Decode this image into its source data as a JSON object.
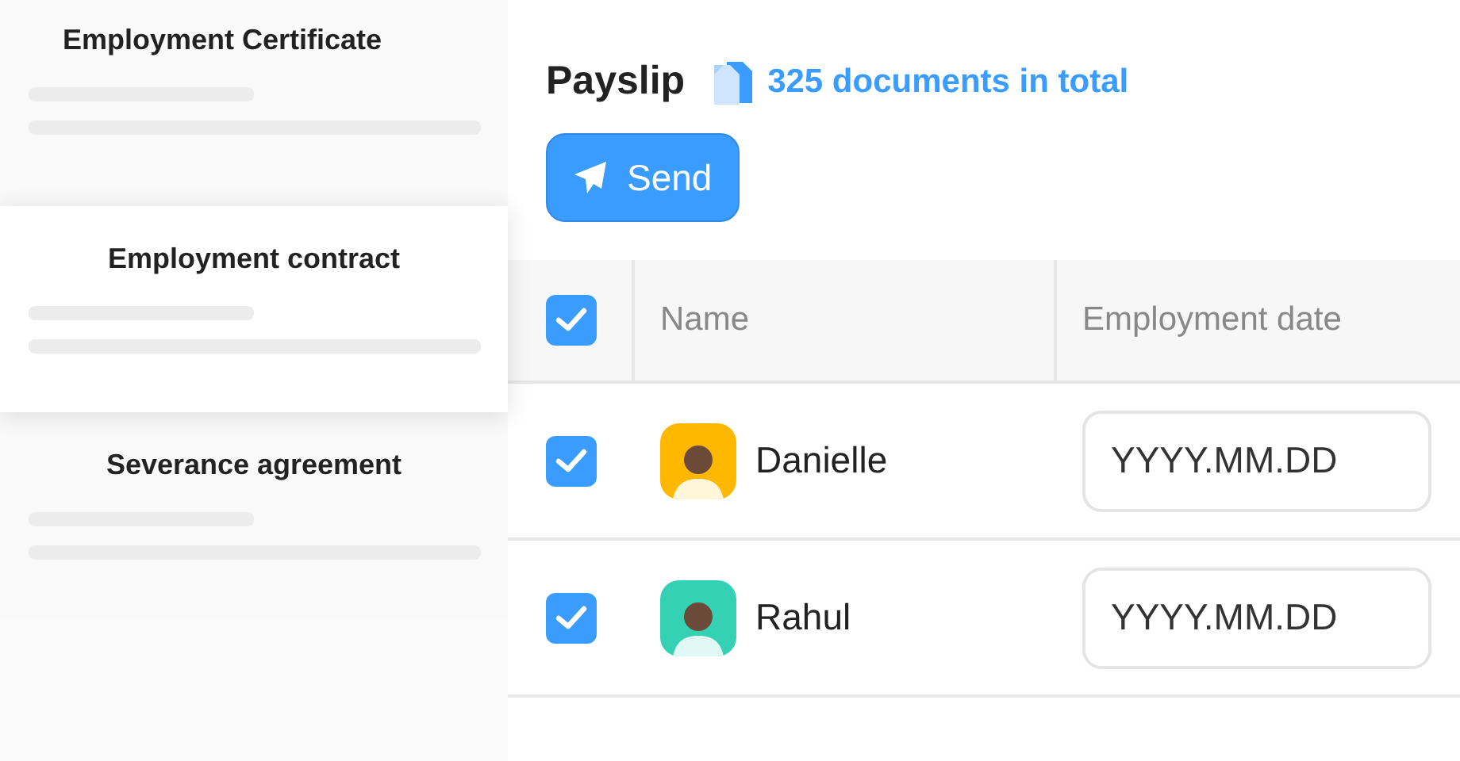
{
  "documents": [
    {
      "title": "Employment Certificate",
      "selected": false
    },
    {
      "title": "Employment contract",
      "selected": true
    },
    {
      "title": "Severance agreement",
      "selected": false
    }
  ],
  "header": {
    "title": "Payslip",
    "count": "325 documents in total"
  },
  "send_button": {
    "label": "Send"
  },
  "table": {
    "all_checked": true,
    "columns": [
      "Name",
      "Employment date"
    ],
    "rows": [
      {
        "checked": true,
        "name": "Danielle",
        "color": "#ffb800",
        "date_placeholder": "YYYY.MM.DD"
      },
      {
        "checked": true,
        "name": "Rahul",
        "color": "#34d1b4",
        "date_placeholder": "YYYY.MM.DD"
      }
    ]
  }
}
